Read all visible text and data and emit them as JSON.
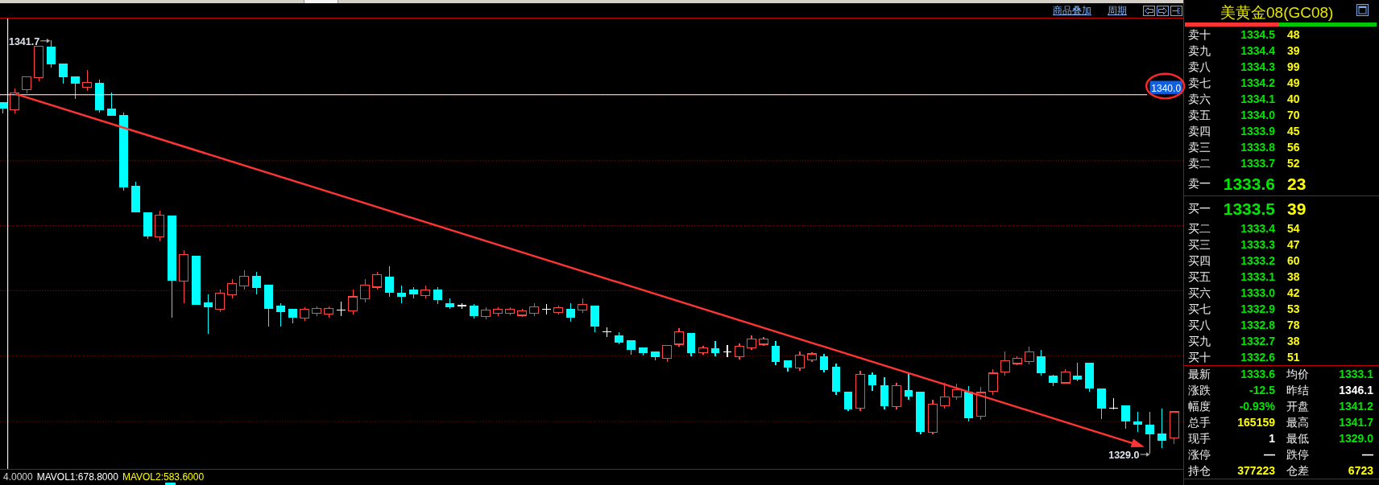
{
  "chart_toolbar": {
    "links": [
      "商品叠加",
      "周期"
    ]
  },
  "chart": {
    "high_label": "1341.7",
    "low_label": "1329.0",
    "crosshair_price": "1340.0"
  },
  "indicators": [
    {
      "text": "4.0000",
      "color": "#d0d0d0"
    },
    {
      "text": "MAVOL1:678.8000",
      "color": "#ffffff"
    },
    {
      "text": "MAVOL2:583.6000",
      "color": "#ffff00"
    }
  ],
  "quote_panel": {
    "title": "美黄金08(GC08)",
    "sell_buy_bar": {
      "level": 0.49
    },
    "asks": [
      {
        "kind": "depth",
        "label": "卖十",
        "price": "1334.5",
        "volume": "48"
      },
      {
        "kind": "depth",
        "label": "卖九",
        "price": "1334.4",
        "volume": "39"
      },
      {
        "kind": "depth",
        "label": "卖八",
        "price": "1334.3",
        "volume": "99"
      },
      {
        "kind": "depth",
        "label": "卖七",
        "price": "1334.2",
        "volume": "49"
      },
      {
        "kind": "depth",
        "label": "卖六",
        "price": "1334.1",
        "volume": "40"
      },
      {
        "kind": "depth",
        "label": "卖五",
        "price": "1334.0",
        "volume": "70"
      },
      {
        "kind": "depth",
        "label": "卖四",
        "price": "1333.9",
        "volume": "45"
      },
      {
        "kind": "depth",
        "label": "卖三",
        "price": "1333.8",
        "volume": "56"
      },
      {
        "kind": "depth",
        "label": "卖二",
        "price": "1333.7",
        "volume": "52"
      },
      {
        "kind": "best",
        "label": "卖一",
        "price": "1333.6",
        "volume": "23"
      }
    ],
    "bids": [
      {
        "kind": "best",
        "label": "买一",
        "price": "1333.5",
        "volume": "39"
      },
      {
        "kind": "depth",
        "label": "买二",
        "price": "1333.4",
        "volume": "54"
      },
      {
        "kind": "depth",
        "label": "买三",
        "price": "1333.3",
        "volume": "47"
      },
      {
        "kind": "depth",
        "label": "买四",
        "price": "1333.2",
        "volume": "60"
      },
      {
        "kind": "depth",
        "label": "买五",
        "price": "1333.1",
        "volume": "38"
      },
      {
        "kind": "depth",
        "label": "买六",
        "price": "1333.0",
        "volume": "42"
      },
      {
        "kind": "depth",
        "label": "买七",
        "price": "1332.9",
        "volume": "53"
      },
      {
        "kind": "depth",
        "label": "买八",
        "price": "1332.8",
        "volume": "78"
      },
      {
        "kind": "depth",
        "label": "买九",
        "price": "1332.7",
        "volume": "38"
      },
      {
        "kind": "depth",
        "label": "买十",
        "price": "1332.6",
        "volume": "51"
      }
    ],
    "stats": [
      {
        "label": "最新",
        "value": "1333.6",
        "color": "#00e600"
      },
      {
        "label": "均价",
        "value": "1333.1",
        "color": "#00e600"
      },
      {
        "label": "涨跌",
        "value": "-12.5",
        "color": "#00e600"
      },
      {
        "label": "昨结",
        "value": "1346.1",
        "color": "#ffffff"
      },
      {
        "label": "幅度",
        "value": "-0.93%",
        "color": "#00e600"
      },
      {
        "label": "开盘",
        "value": "1341.2",
        "color": "#00e600"
      },
      {
        "label": "总手",
        "value": "165159",
        "color": "#ffff00"
      },
      {
        "label": "最高",
        "value": "1341.7",
        "color": "#00e600"
      },
      {
        "label": "现手",
        "value": "1",
        "color": "#ffffff"
      },
      {
        "label": "最低",
        "value": "1329.0",
        "color": "#00e600"
      },
      {
        "label": "涨停",
        "value": "—",
        "color": "#ffffff"
      },
      {
        "label": "跌停",
        "value": "—",
        "color": "#ffffff"
      },
      {
        "label": "持仓",
        "value": "377223",
        "color": "#ffff00"
      },
      {
        "label": "仓差",
        "value": "6723",
        "color": "#ffff00"
      }
    ]
  }
}
